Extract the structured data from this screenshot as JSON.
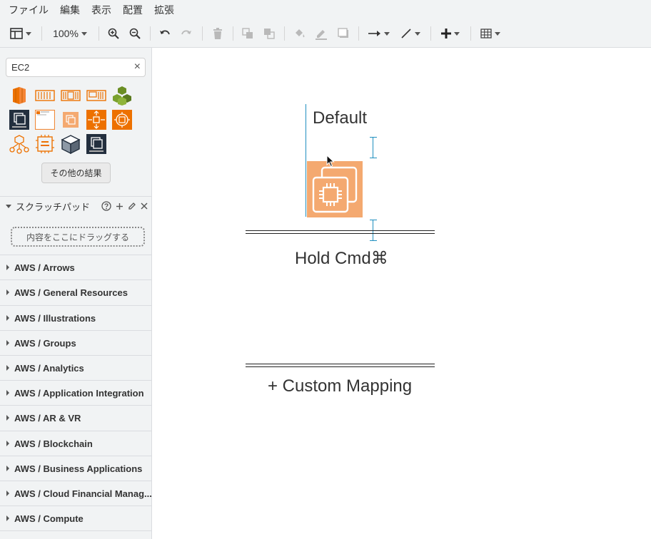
{
  "menu": {
    "items": [
      "ファイル",
      "編集",
      "表示",
      "配置",
      "拡張"
    ]
  },
  "toolbar": {
    "zoom": "100%"
  },
  "search": {
    "value": "EC2",
    "clear_icon": "×"
  },
  "shapes": {
    "more_results": "その他の結果"
  },
  "scratchpad": {
    "title": "スクラッチパッド",
    "drop_hint": "内容をここにドラッグする"
  },
  "libraries": [
    "AWS / Arrows",
    "AWS / General Resources",
    "AWS / Illustrations",
    "AWS / Groups",
    "AWS / Analytics",
    "AWS / Application Integration",
    "AWS / AR & VR",
    "AWS / Blockchain",
    "AWS / Business Applications",
    "AWS / Cloud Financial Manag...",
    "AWS / Compute"
  ],
  "canvas": {
    "default_label": "Default",
    "hold_label": "Hold Cmd⌘",
    "custom_label": "+ Custom Mapping"
  },
  "colors": {
    "aws_orange": "#ed7100",
    "ec2_light": "#f4a970",
    "squid_ink": "#232f3e",
    "guide_blue": "#1f8fbf"
  }
}
